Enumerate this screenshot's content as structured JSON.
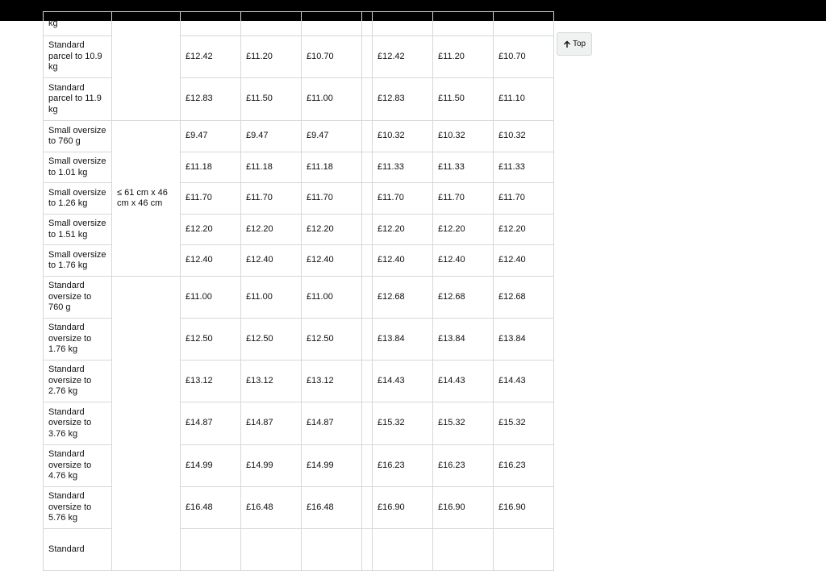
{
  "top_button": {
    "label": "Top",
    "icon": "arrow-up-icon"
  },
  "table": {
    "rows": [
      {
        "name": "kg",
        "prices": [
          "",
          "",
          "",
          "",
          "",
          ""
        ]
      },
      {
        "name": "Standard parcel to 10.9 kg",
        "prices": [
          "£12.42",
          "£11.20",
          "£10.70",
          "£12.42",
          "£11.20",
          "£10.70"
        ]
      },
      {
        "name": "Standard parcel to 11.9 kg",
        "prices": [
          "£12.83",
          "£11.50",
          "£11.00",
          "£12.83",
          "£11.50",
          "£11.10"
        ]
      },
      {
        "name": "Small oversize to 760 g",
        "prices": [
          "£9.47",
          "£9.47",
          "£9.47",
          "£10.32",
          "£10.32",
          "£10.32"
        ]
      },
      {
        "name": "Small oversize to 1.01 kg",
        "prices": [
          "£11.18",
          "£11.18",
          "£11.18",
          "£11.33",
          "£11.33",
          "£11.33"
        ]
      },
      {
        "name": "Small oversize to 1.26 kg",
        "prices": [
          "£11.70",
          "£11.70",
          "£11.70",
          "£11.70",
          "£11.70",
          "£11.70"
        ]
      },
      {
        "name": "Small oversize to 1.51 kg",
        "prices": [
          "£12.20",
          "£12.20",
          "£12.20",
          "£12.20",
          "£12.20",
          "£12.20"
        ]
      },
      {
        "name": "Small oversize to 1.76 kg",
        "prices": [
          "£12.40",
          "£12.40",
          "£12.40",
          "£12.40",
          "£12.40",
          "£12.40"
        ]
      },
      {
        "name": "Standard oversize to 760 g",
        "prices": [
          "£11.00",
          "£11.00",
          "£11.00",
          "£12.68",
          "£12.68",
          "£12.68"
        ]
      },
      {
        "name": "Standard oversize to 1.76 kg",
        "prices": [
          "£12.50",
          "£12.50",
          "£12.50",
          "£13.84",
          "£13.84",
          "£13.84"
        ]
      },
      {
        "name": "Standard oversize to 2.76 kg",
        "prices": [
          "£13.12",
          "£13.12",
          "£13.12",
          "£14.43",
          "£14.43",
          "£14.43"
        ]
      },
      {
        "name": "Standard oversize to 3.76 kg",
        "prices": [
          "£14.87",
          "£14.87",
          "£14.87",
          "£15.32",
          "£15.32",
          "£15.32"
        ]
      },
      {
        "name": "Standard oversize to 4.76 kg",
        "prices": [
          "£14.99",
          "£14.99",
          "£14.99",
          "£16.23",
          "£16.23",
          "£16.23"
        ]
      },
      {
        "name": "Standard oversize to 5.76 kg",
        "prices": [
          "£16.48",
          "£16.48",
          "£16.48",
          "£16.90",
          "£16.90",
          "£16.90"
        ]
      },
      {
        "name": "Standard",
        "prices": [
          "",
          "",
          "",
          "",
          "",
          ""
        ]
      }
    ],
    "size_groups": [
      {
        "label": "",
        "row_start": 0,
        "row_count": 3
      },
      {
        "label": "≤ 61 cm x 46 cm x 46 cm",
        "row_start": 3,
        "row_count": 5
      },
      {
        "label": "",
        "row_start": 8,
        "row_count": 7
      }
    ]
  }
}
